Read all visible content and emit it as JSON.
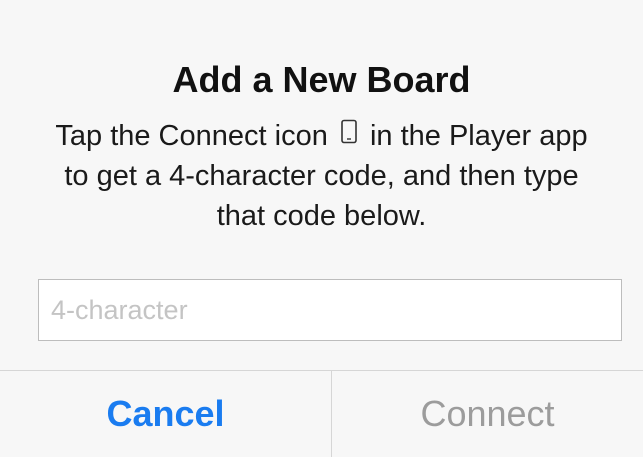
{
  "dialog": {
    "title": "Add a New Board",
    "message": {
      "before_icon": "Tap the Connect icon",
      "icon": "phone-icon",
      "after_icon": "in the Player app to get a 4-character code, and then type that code below."
    },
    "input": {
      "value": "",
      "placeholder": "4-character"
    },
    "buttons": {
      "cancel_label": "Cancel",
      "connect_label": "Connect"
    },
    "colors": {
      "accent": "#1a7cf0",
      "disabled_text": "#9c9c9c",
      "background": "#f7f7f7"
    }
  }
}
